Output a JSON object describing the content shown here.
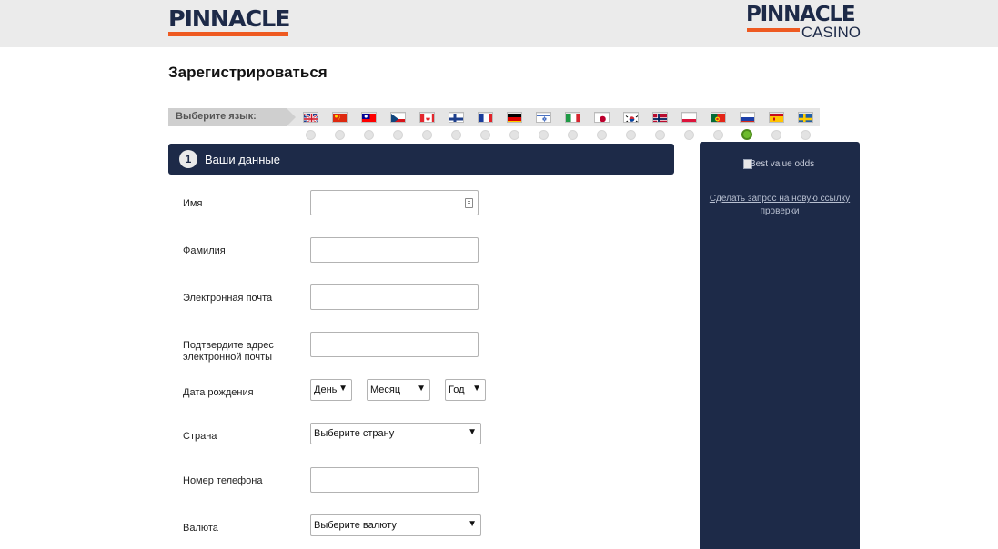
{
  "header": {
    "logo_left": "PINNACLE",
    "logo_right_top": "PINNACLE",
    "logo_right_bottom": "CASINO"
  },
  "page_title": "Зарегистрироваться",
  "language": {
    "label": "Выберите язык:",
    "selected": "Русский",
    "flags": [
      "en-gb",
      "zh-cn",
      "zh-tw",
      "cs",
      "en-ca",
      "fi",
      "fr",
      "de",
      "he",
      "it",
      "ja",
      "ko",
      "no",
      "pl",
      "pt",
      "ru",
      "es",
      "sv"
    ]
  },
  "section": {
    "step": "1",
    "title": "Ваши данные"
  },
  "form": {
    "first_name_label": "Имя",
    "last_name_label": "Фамилия",
    "email_label": "Электронная почта",
    "confirm_email_label_line1": "Подтвердите адрес",
    "confirm_email_label_line2": "электронной почты",
    "dob_label": "Дата рождения",
    "dob_day": "День",
    "dob_month": "Месяц",
    "dob_year": "Год",
    "country_label": "Страна",
    "country_value": "Выберите страну",
    "phone_label": "Номер телефона",
    "currency_label": "Валюта",
    "currency_value": "Выберите валюту"
  },
  "sidebar": {
    "image_alt": "Best value odds",
    "link_text": "Сделать запрос на новую ссылку проверки"
  },
  "colors": {
    "navy": "#1d2a48",
    "orange": "#ee5a21",
    "active_radio": "#6dbb2d"
  }
}
